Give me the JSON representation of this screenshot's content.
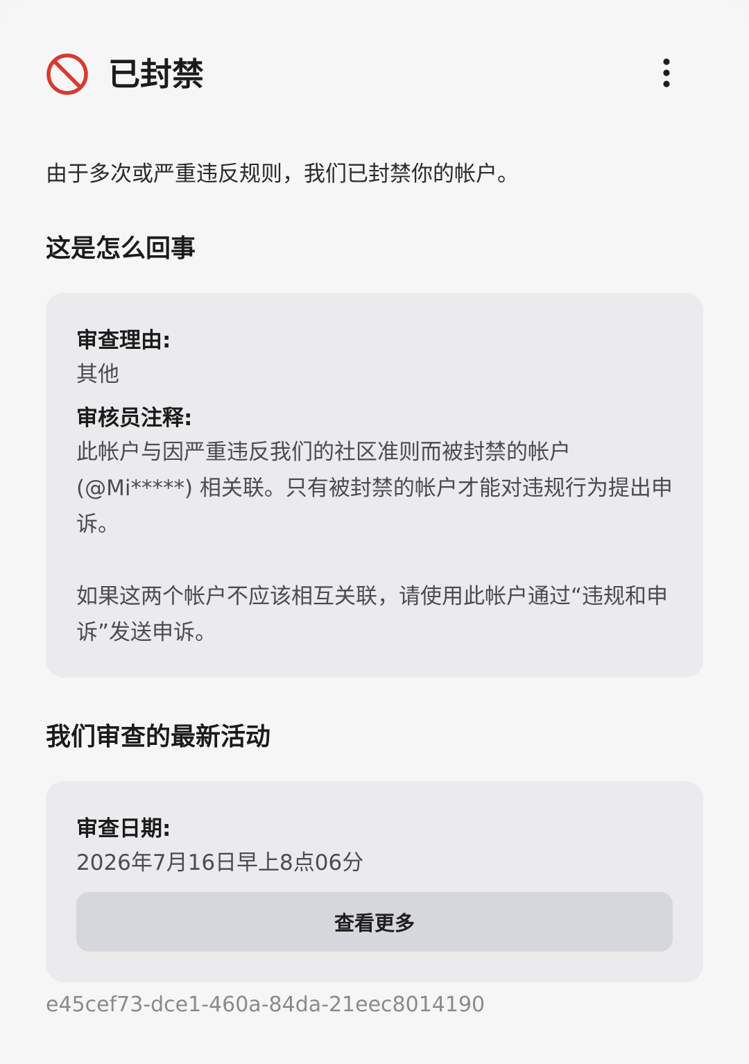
{
  "header": {
    "title": "已封禁",
    "icon": "ban-icon",
    "menu_icon": "more-vertical-icon",
    "accent_color": "#d63a31"
  },
  "intro": "由于多次或严重违反规则，我们已封禁你的帐户。",
  "what_happened": {
    "title": "这是怎么回事",
    "reason_label": "审查理由:",
    "reason_value": "其他",
    "note_label": "审核员注释:",
    "note_paragraph_1": "此帐户与因严重违反我们的社区准则而被封禁的帐户(@Mi*****) 相关联。只有被封禁的帐户才能对违规行为提出申诉。",
    "note_paragraph_2": "如果这两个帐户不应该相互关联，请使用此帐户通过“违规和申诉”发送申诉。"
  },
  "latest_activity": {
    "title": "我们审查的最新活动",
    "date_label": "审查日期:",
    "date_value": "2026年7月16日早上8点06分",
    "view_more_label": "查看更多"
  },
  "reference_id": "e45cef73-dce1-460a-84da-21eec8014190"
}
